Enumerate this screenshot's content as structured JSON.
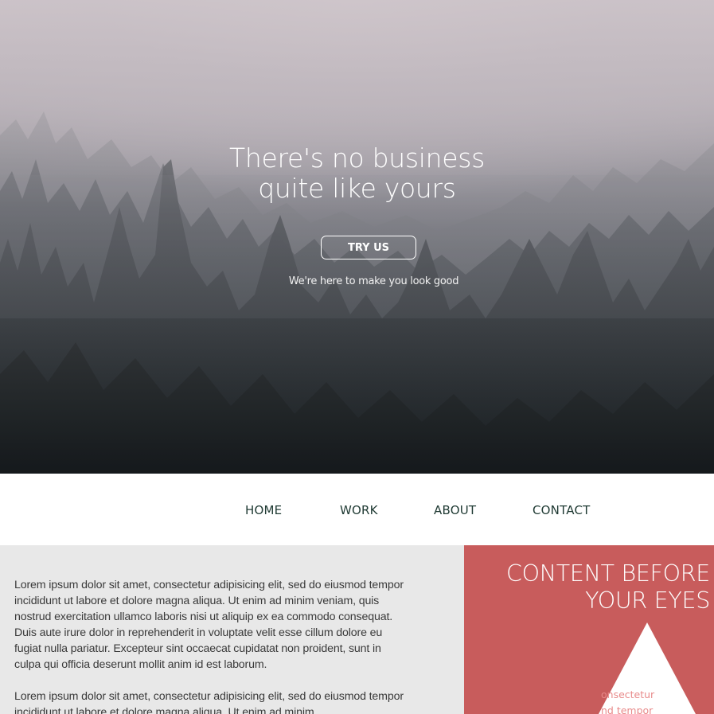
{
  "hero": {
    "title": "There's no business\nquite like yours",
    "button_label": "TRY US",
    "tagline": "We're here to make you look good"
  },
  "nav": {
    "items": [
      {
        "label": "HOME"
      },
      {
        "label": "WORK"
      },
      {
        "label": "ABOUT"
      },
      {
        "label": "CONTACT"
      }
    ]
  },
  "content": {
    "paragraphs": [
      "Lorem ipsum dolor sit amet, consectetur adipisicing elit, sed do eiusmod tempor incididunt ut labore et dolore magna aliqua. Ut enim ad minim veniam, quis nostrud exercitation ullamco laboris nisi ut aliquip ex ea commodo consequat. Duis aute irure dolor in reprehenderit in voluptate velit esse cillum dolore eu fugiat nulla pariatur. Excepteur sint occaecat cupidatat non proident, sunt in culpa qui officia deserunt mollit anim id est laborum.",
      "Lorem ipsum dolor sit amet, consectetur adipisicing elit, sed do eiusmod tempor incididunt ut labore et dolore magna aliqua. Ut enim ad minim"
    ]
  },
  "side_panel": {
    "title": "CONTENT BEFORE YOUR EYES",
    "snippet": "onsectetur\nnd tempor"
  },
  "colors": {
    "panel_red": "#c85c5c",
    "nav_text": "#1f3a33",
    "content_bg": "#e8e8e8"
  }
}
